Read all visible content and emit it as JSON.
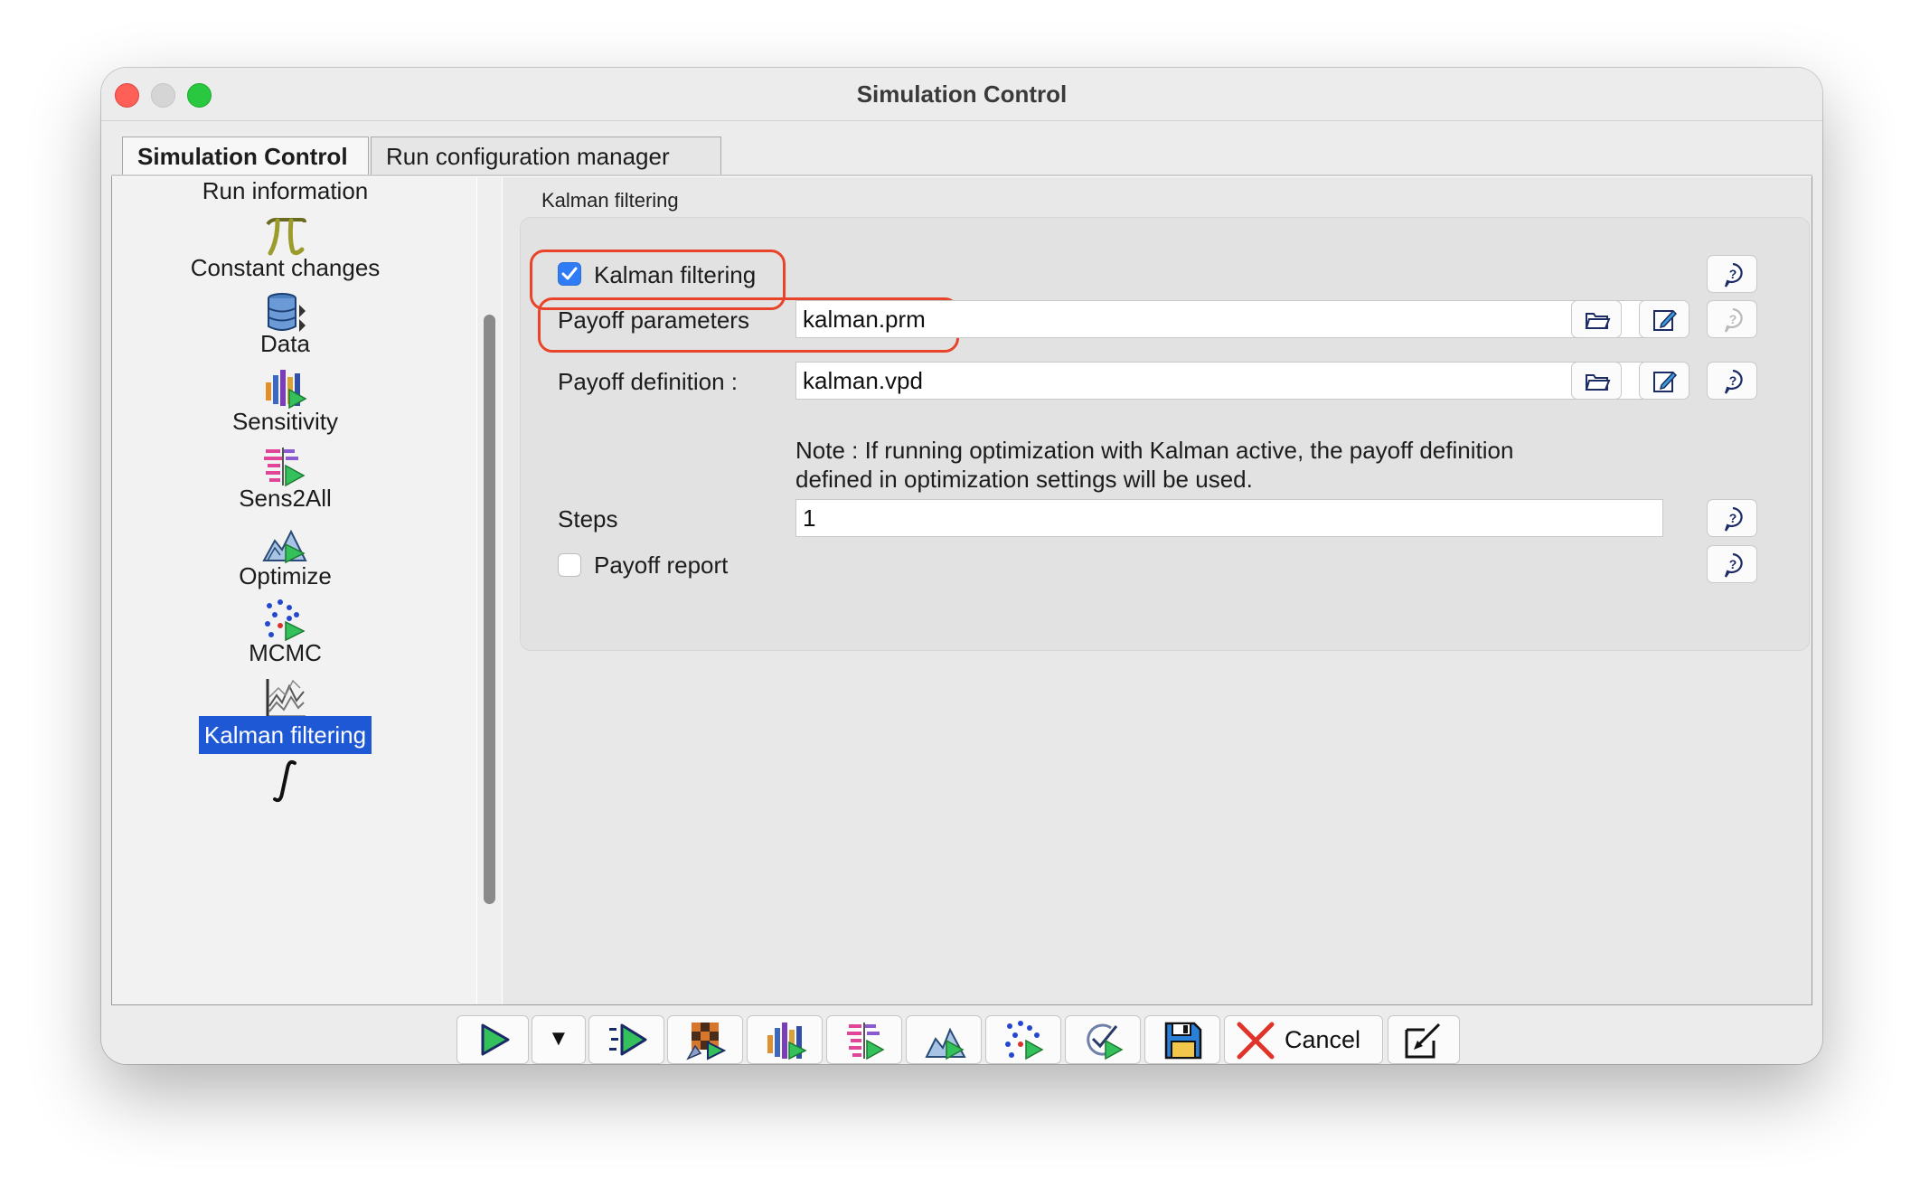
{
  "window": {
    "title": "Simulation Control"
  },
  "tabs": [
    {
      "label": "Simulation Control",
      "active": true
    },
    {
      "label": "Run configuration manager",
      "active": false
    }
  ],
  "sidebar": {
    "items": [
      {
        "label": "Run information",
        "icon": "pi-icon"
      },
      {
        "label": "Constant changes",
        "icon": "database-icon"
      },
      {
        "label": "Data",
        "icon": "data-bars-icon"
      },
      {
        "label": "Sensitivity",
        "icon": "sensitivity-icon"
      },
      {
        "label": "Sens2All",
        "icon": "mountain-play-icon"
      },
      {
        "label": "Optimize",
        "icon": "scatter-play-icon"
      },
      {
        "label": "MCMC",
        "icon": "line-chart-icon"
      },
      {
        "label": "Kalman filtering",
        "icon": "integral-icon",
        "selected": true
      }
    ]
  },
  "group": {
    "title": "Kalman filtering",
    "kalman_checkbox": {
      "label": "Kalman filtering",
      "checked": true
    },
    "payoff_parameters": {
      "label": "Payoff parameters",
      "value": "kalman.prm"
    },
    "payoff_definition": {
      "label": "Payoff definition :",
      "value": "kalman.vpd"
    },
    "note_line1": "Note : If running optimization with Kalman active, the payoff definition",
    "note_line2": "defined in optimization settings will be used.",
    "steps": {
      "label": "Steps",
      "value": "1"
    },
    "payoff_report": {
      "label": "Payoff report",
      "checked": false
    }
  },
  "toolbar": {
    "cancel_label": "Cancel",
    "dropdown_arrow": "▼"
  },
  "colors": {
    "accent": "#1e58d4",
    "checkbox_blue": "#2f7cf6",
    "highlight_outline": "#e8442a",
    "play_green": "#34c05a"
  }
}
